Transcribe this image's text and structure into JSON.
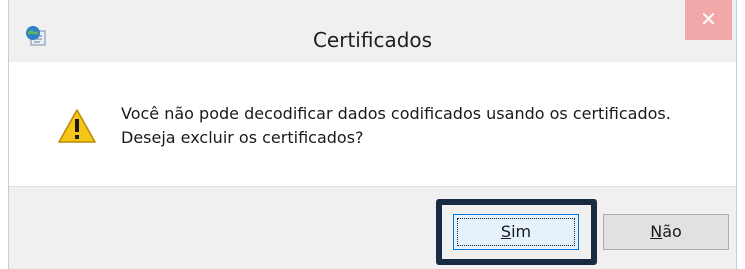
{
  "window": {
    "title": "Certificados",
    "close_symbol": "✕"
  },
  "dialog": {
    "message_line1": "Você não pode decodificar dados codificados usando os certificados.",
    "message_line2": "Deseja excluir os certificados?",
    "icon": "warning-icon"
  },
  "buttons": {
    "yes": {
      "accel": "S",
      "rest": "im"
    },
    "no": {
      "accel": "N",
      "rest": "ão"
    }
  },
  "colors": {
    "focus_frame": "#1a2a42",
    "close_button": "#f2a8a8",
    "warning_yellow": "#f5c518"
  }
}
